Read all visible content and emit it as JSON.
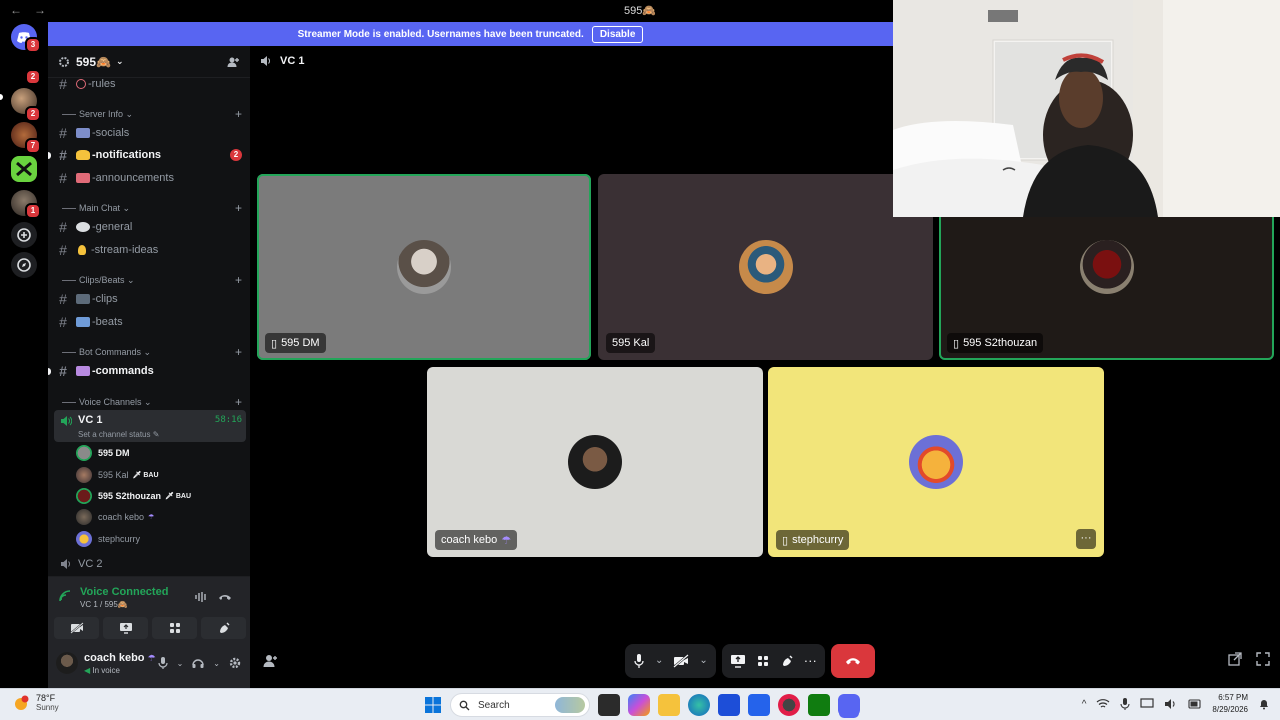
{
  "window": {
    "back": "←",
    "forward": "→",
    "title": "595🙈"
  },
  "banner": {
    "text": "Streamer Mode is enabled. Usernames have been truncated.",
    "button": "Disable"
  },
  "rail": {
    "badges": [
      "3",
      "2",
      "2",
      "7",
      "1"
    ]
  },
  "server": {
    "name": "595🙈"
  },
  "channels": {
    "rules": "-rules",
    "cat_server_info": "Server Info",
    "socials": "-socials",
    "notifications": "-notifications",
    "notifications_count": "2",
    "announcements": "-announcements",
    "cat_main_chat": "Main Chat",
    "general": "-general",
    "stream_ideas": "-stream-ideas",
    "cat_clips": "Clips/Beats",
    "clips": "-clips",
    "beats": "-beats",
    "cat_bot": "Bot Commands",
    "commands": "-commands",
    "cat_voice": "Voice Channels",
    "vc1": "VC 1",
    "vc1_status": "Set a channel status",
    "vc1_timer": "58:16",
    "vc2": "VC 2"
  },
  "voice_users": [
    {
      "name": "595 DM",
      "tag": ""
    },
    {
      "name": "595 Kal",
      "tag": "BAU"
    },
    {
      "name": "595 S2thouzan",
      "tag": "BAU"
    },
    {
      "name": "coach kebo",
      "tag": ""
    },
    {
      "name": "stephcurry",
      "tag": ""
    }
  ],
  "voice_panel": {
    "status": "Voice Connected",
    "sub": "VC 1 / 595🙈"
  },
  "user_panel": {
    "name": "coach kebo",
    "status": "In voice"
  },
  "main": {
    "channel": "VC 1"
  },
  "tiles": [
    {
      "name": "595 DM",
      "bg": "#7b7b7b",
      "speaking": true
    },
    {
      "name": "595 Kal",
      "bg": "#3a3034",
      "speaking": false
    },
    {
      "name": "595 S2thouzan",
      "bg": "#1f1a17",
      "speaking": true
    },
    {
      "name": "coach kebo",
      "bg": "#d9d9d5",
      "speaking": false
    },
    {
      "name": "stephcurry",
      "bg": "#f2e57a",
      "speaking": false
    }
  ],
  "taskbar": {
    "weather_temp": "78°F",
    "weather_desc": "Sunny",
    "search": "Search",
    "time": "6:57 PM",
    "date": "8/29/2026"
  },
  "colors": {
    "blurple": "#5865f2",
    "green": "#23a559",
    "red": "#da373c"
  }
}
